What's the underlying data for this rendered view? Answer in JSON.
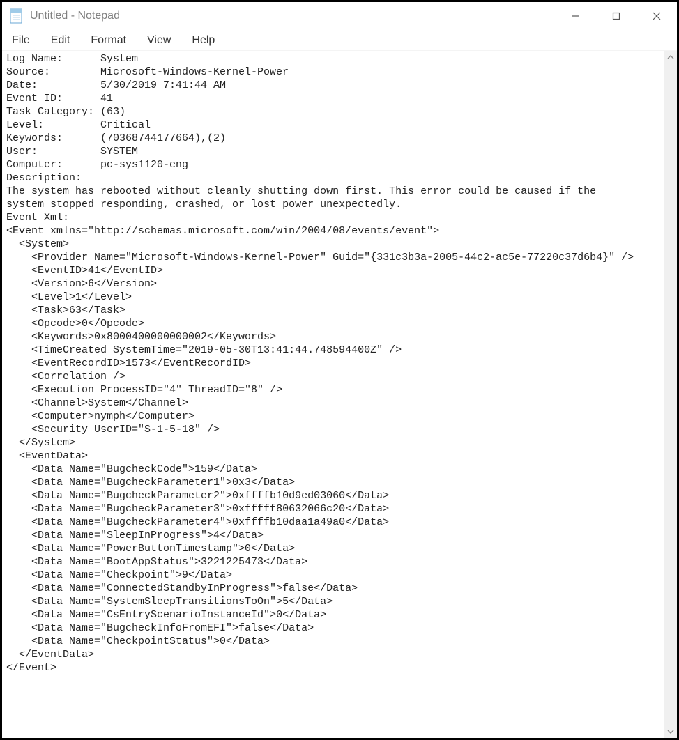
{
  "window": {
    "title": "Untitled - Notepad"
  },
  "menu": {
    "file": "File",
    "edit": "Edit",
    "format": "Format",
    "view": "View",
    "help": "Help"
  },
  "header": {
    "log_name_label": "Log Name:",
    "log_name_value": "System",
    "source_label": "Source:",
    "source_value": "Microsoft-Windows-Kernel-Power",
    "date_label": "Date:",
    "date_value": "5/30/2019 7:41:44 AM",
    "event_id_label": "Event ID:",
    "event_id_value": "41",
    "task_category_label": "Task Category:",
    "task_category_value": "(63)",
    "level_label": "Level:",
    "level_value": "Critical",
    "keywords_label": "Keywords:",
    "keywords_value": "(70368744177664),(2)",
    "user_label": "User:",
    "user_value": "SYSTEM",
    "computer_label": "Computer:",
    "computer_value": "pc-sys1120-eng",
    "description_label": "Description:",
    "description_text": "The system has rebooted without cleanly shutting down first. This error could be caused if the\nsystem stopped responding, crashed, or lost power unexpectedly.",
    "event_xml_label": "Event Xml:"
  },
  "xml": {
    "l01": "<Event xmlns=\"http://schemas.microsoft.com/win/2004/08/events/event\">",
    "l02": "  <System>",
    "l03": "    <Provider Name=\"Microsoft-Windows-Kernel-Power\" Guid=\"{331c3b3a-2005-44c2-ac5e-77220c37d6b4}\" />",
    "l04": "    <EventID>41</EventID>",
    "l05": "    <Version>6</Version>",
    "l06": "    <Level>1</Level>",
    "l07": "    <Task>63</Task>",
    "l08": "    <Opcode>0</Opcode>",
    "l09": "    <Keywords>0x8000400000000002</Keywords>",
    "l10": "    <TimeCreated SystemTime=\"2019-05-30T13:41:44.748594400Z\" />",
    "l11": "    <EventRecordID>1573</EventRecordID>",
    "l12": "    <Correlation />",
    "l13": "    <Execution ProcessID=\"4\" ThreadID=\"8\" />",
    "l14": "    <Channel>System</Channel>",
    "l15": "    <Computer>nymph</Computer>",
    "l16": "    <Security UserID=\"S-1-5-18\" />",
    "l17": "  </System>",
    "l18": "  <EventData>",
    "l19": "    <Data Name=\"BugcheckCode\">159</Data>",
    "l20": "    <Data Name=\"BugcheckParameter1\">0x3</Data>",
    "l21": "    <Data Name=\"BugcheckParameter2\">0xffffb10d9ed03060</Data>",
    "l22": "    <Data Name=\"BugcheckParameter3\">0xfffff80632066c20</Data>",
    "l23": "    <Data Name=\"BugcheckParameter4\">0xffffb10daa1a49a0</Data>",
    "l24": "    <Data Name=\"SleepInProgress\">4</Data>",
    "l25": "    <Data Name=\"PowerButtonTimestamp\">0</Data>",
    "l26": "    <Data Name=\"BootAppStatus\">3221225473</Data>",
    "l27": "    <Data Name=\"Checkpoint\">9</Data>",
    "l28": "    <Data Name=\"ConnectedStandbyInProgress\">false</Data>",
    "l29": "    <Data Name=\"SystemSleepTransitionsToOn\">5</Data>",
    "l30": "    <Data Name=\"CsEntryScenarioInstanceId\">0</Data>",
    "l31": "    <Data Name=\"BugcheckInfoFromEFI\">false</Data>",
    "l32": "    <Data Name=\"CheckpointStatus\">0</Data>",
    "l33": "  </EventData>",
    "l34": "</Event>"
  }
}
